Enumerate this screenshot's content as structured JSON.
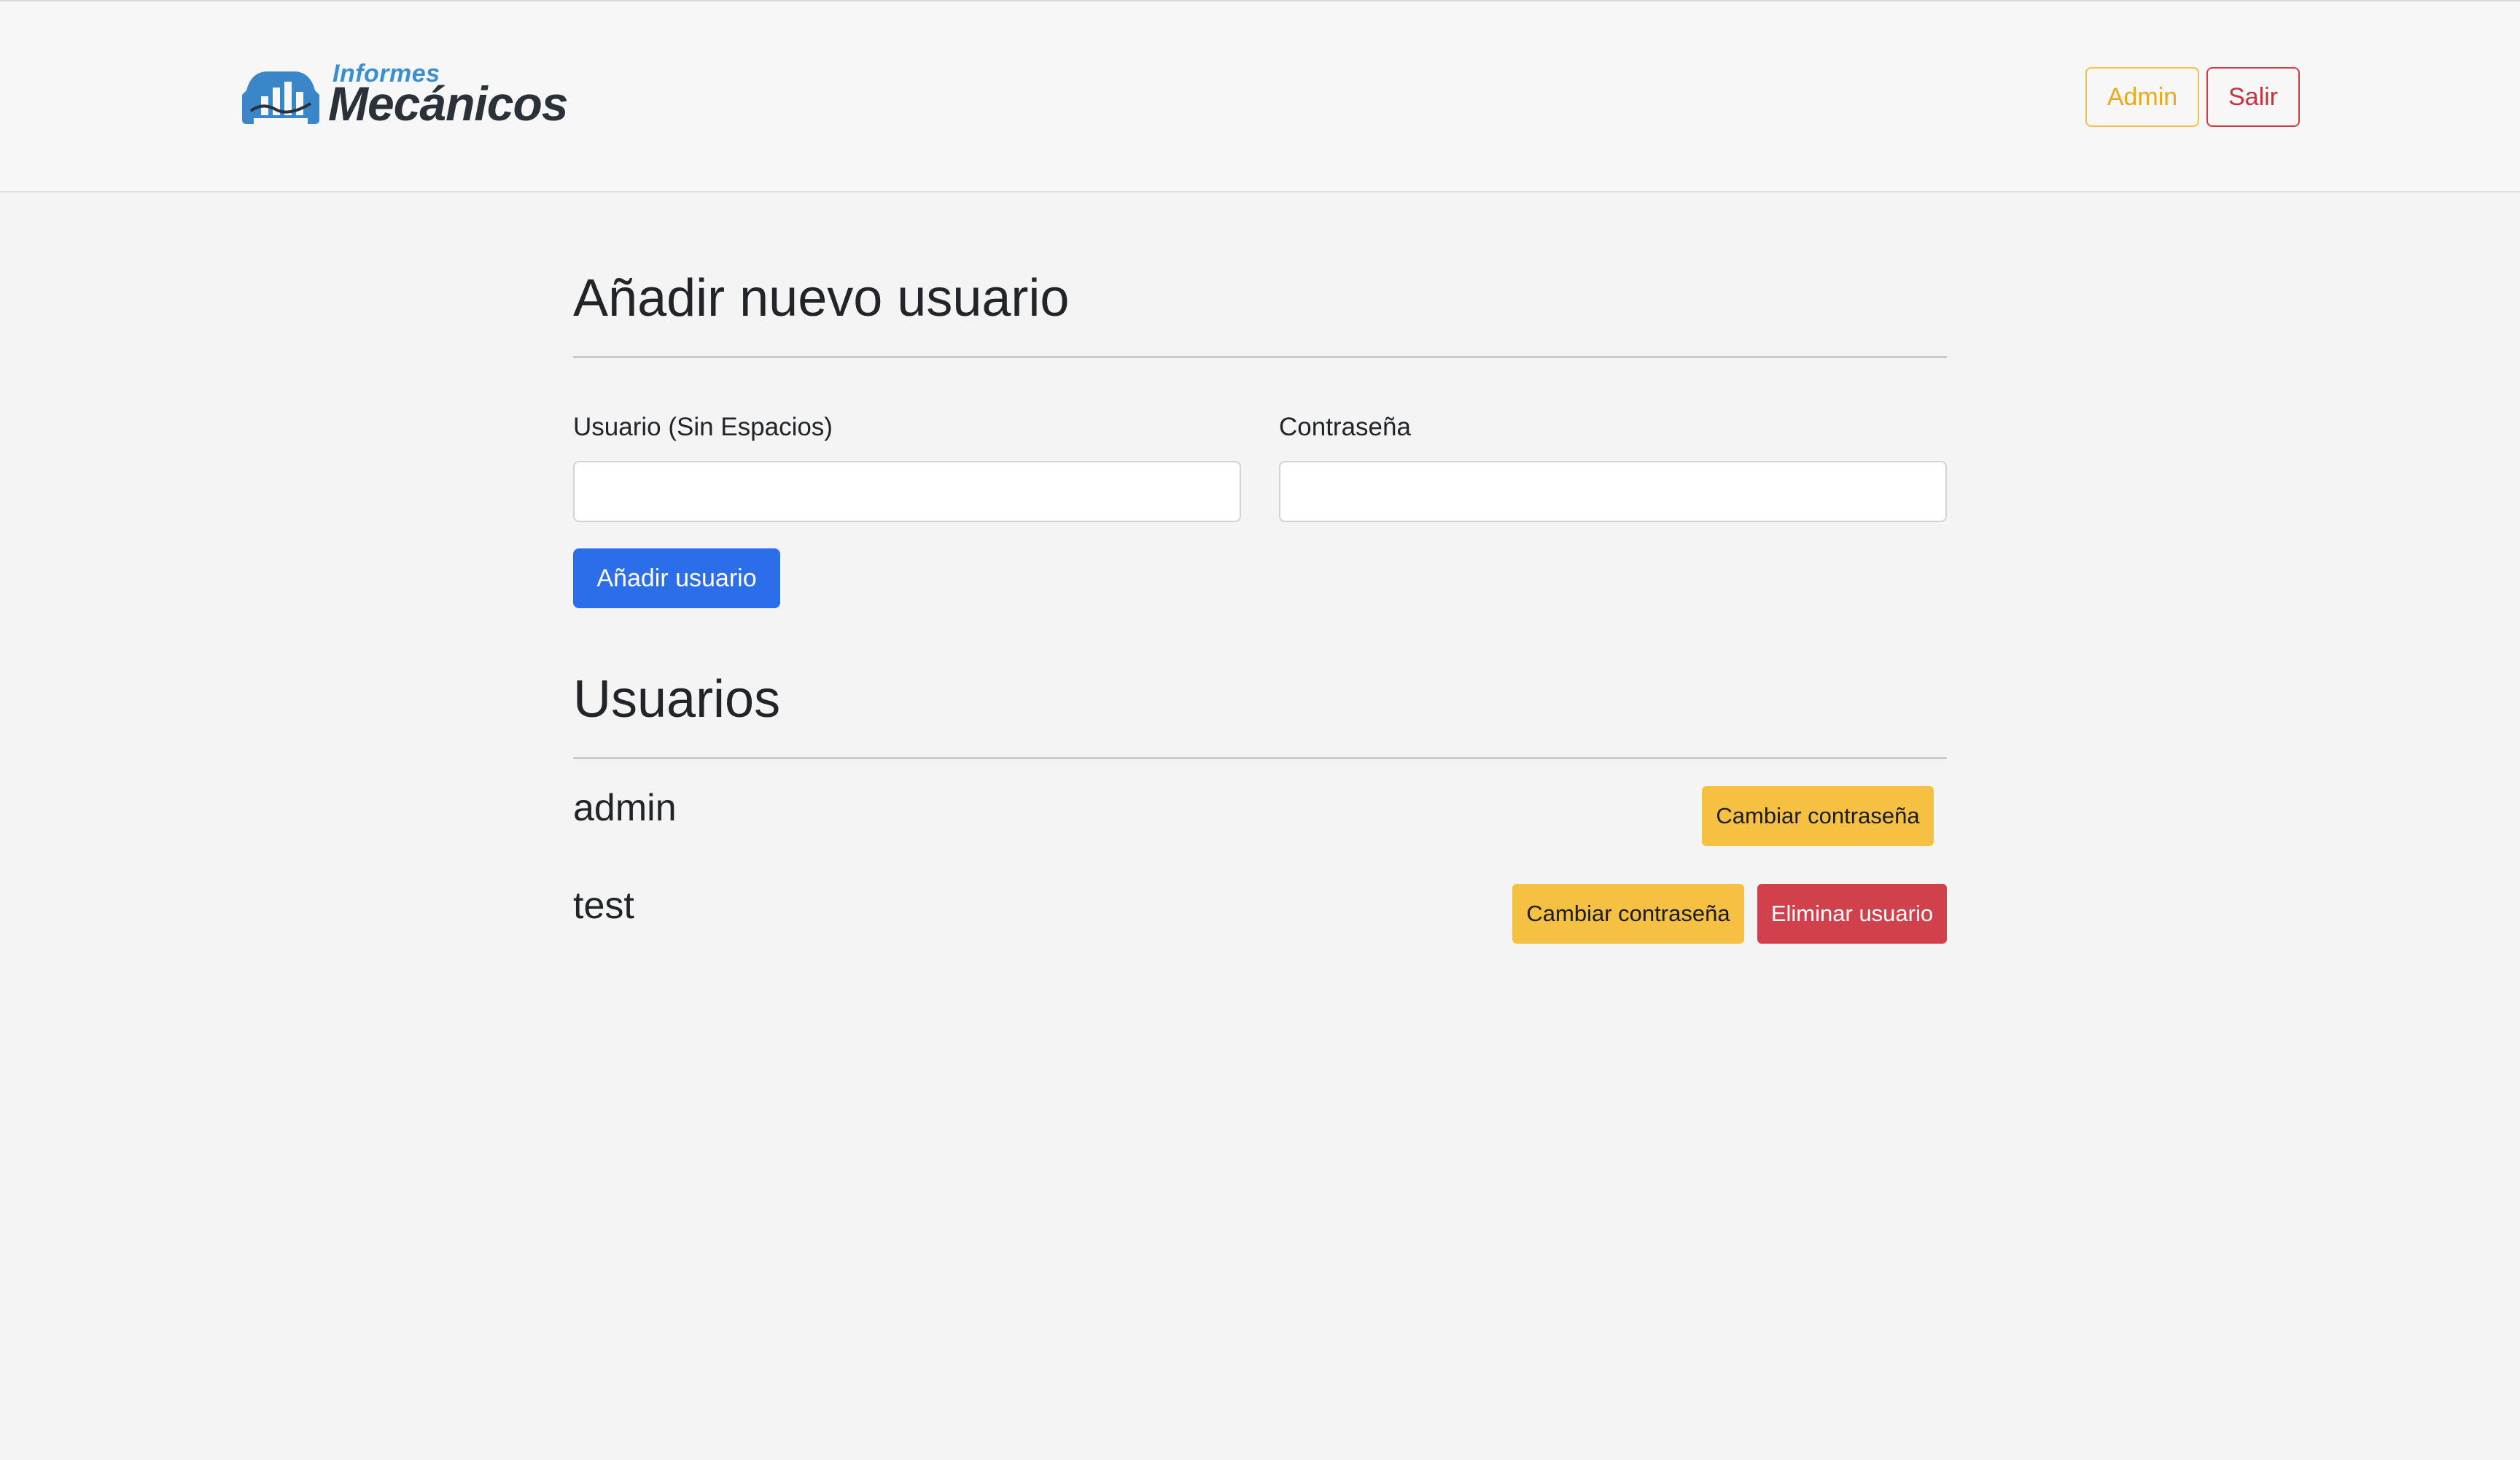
{
  "brand": {
    "small_text": "Informes",
    "big_text": "Mecánicos",
    "icon": "car-chart-logo-icon",
    "colors": {
      "primary": "#3a8fd0",
      "dark": "#2b3138"
    }
  },
  "nav": {
    "admin_label": "Admin",
    "logout_label": "Salir"
  },
  "add_user": {
    "title": "Añadir nuevo usuario",
    "username_label": "Usuario (Sin Espacios)",
    "username_value": "",
    "password_label": "Contraseña",
    "password_value": "",
    "submit_label": "Añadir usuario"
  },
  "users": {
    "title": "Usuarios",
    "list": [
      {
        "name": "admin",
        "change_password_label": "Cambiar contraseña"
      },
      {
        "name": "test",
        "change_password_label": "Cambiar contraseña",
        "delete_label": "Eliminar usuario"
      }
    ]
  },
  "colors": {
    "primary_button": "#2c6de9",
    "warning_button": "#f6c142",
    "danger_button": "#d0414b",
    "admin_outline": "#f2c14a",
    "logout_outline": "#d13a44"
  }
}
